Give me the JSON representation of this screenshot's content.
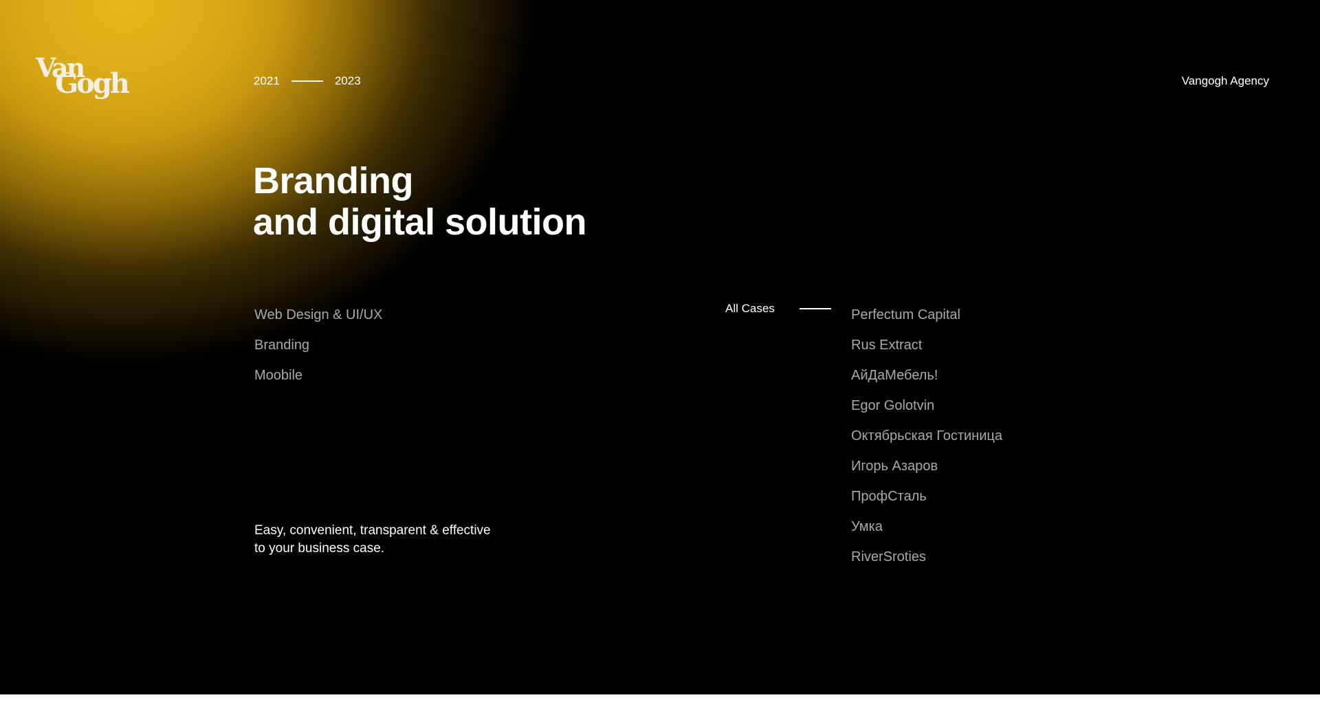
{
  "header": {
    "logo_text_top": "Van",
    "logo_text_bottom": "Gogh",
    "year_start": "2021",
    "year_end": "2023",
    "agency_name": "Vangogh Agency"
  },
  "hero": {
    "title_line1": "Branding",
    "title_line2": "and digital solution"
  },
  "services": [
    "Web Design & UI/UX",
    "Branding",
    "Moobile"
  ],
  "tagline": {
    "line1": "Easy, convenient, transparent & effective",
    "line2": "to your business case."
  },
  "cases_nav": {
    "label": "All Cases",
    "items": [
      "Perfectum Capital",
      "Rus Extract",
      "АйДаМебель!",
      "Egor Golotvin",
      "Октябрьская Гостиница",
      "Игорь Азаров",
      "ПрофСталь",
      "Умка",
      "RiverSroties"
    ]
  },
  "colors": {
    "background": "#000000",
    "glow_accent": "#e6b51a",
    "text_primary": "#ffffff",
    "text_muted": "#a9a9a9"
  }
}
